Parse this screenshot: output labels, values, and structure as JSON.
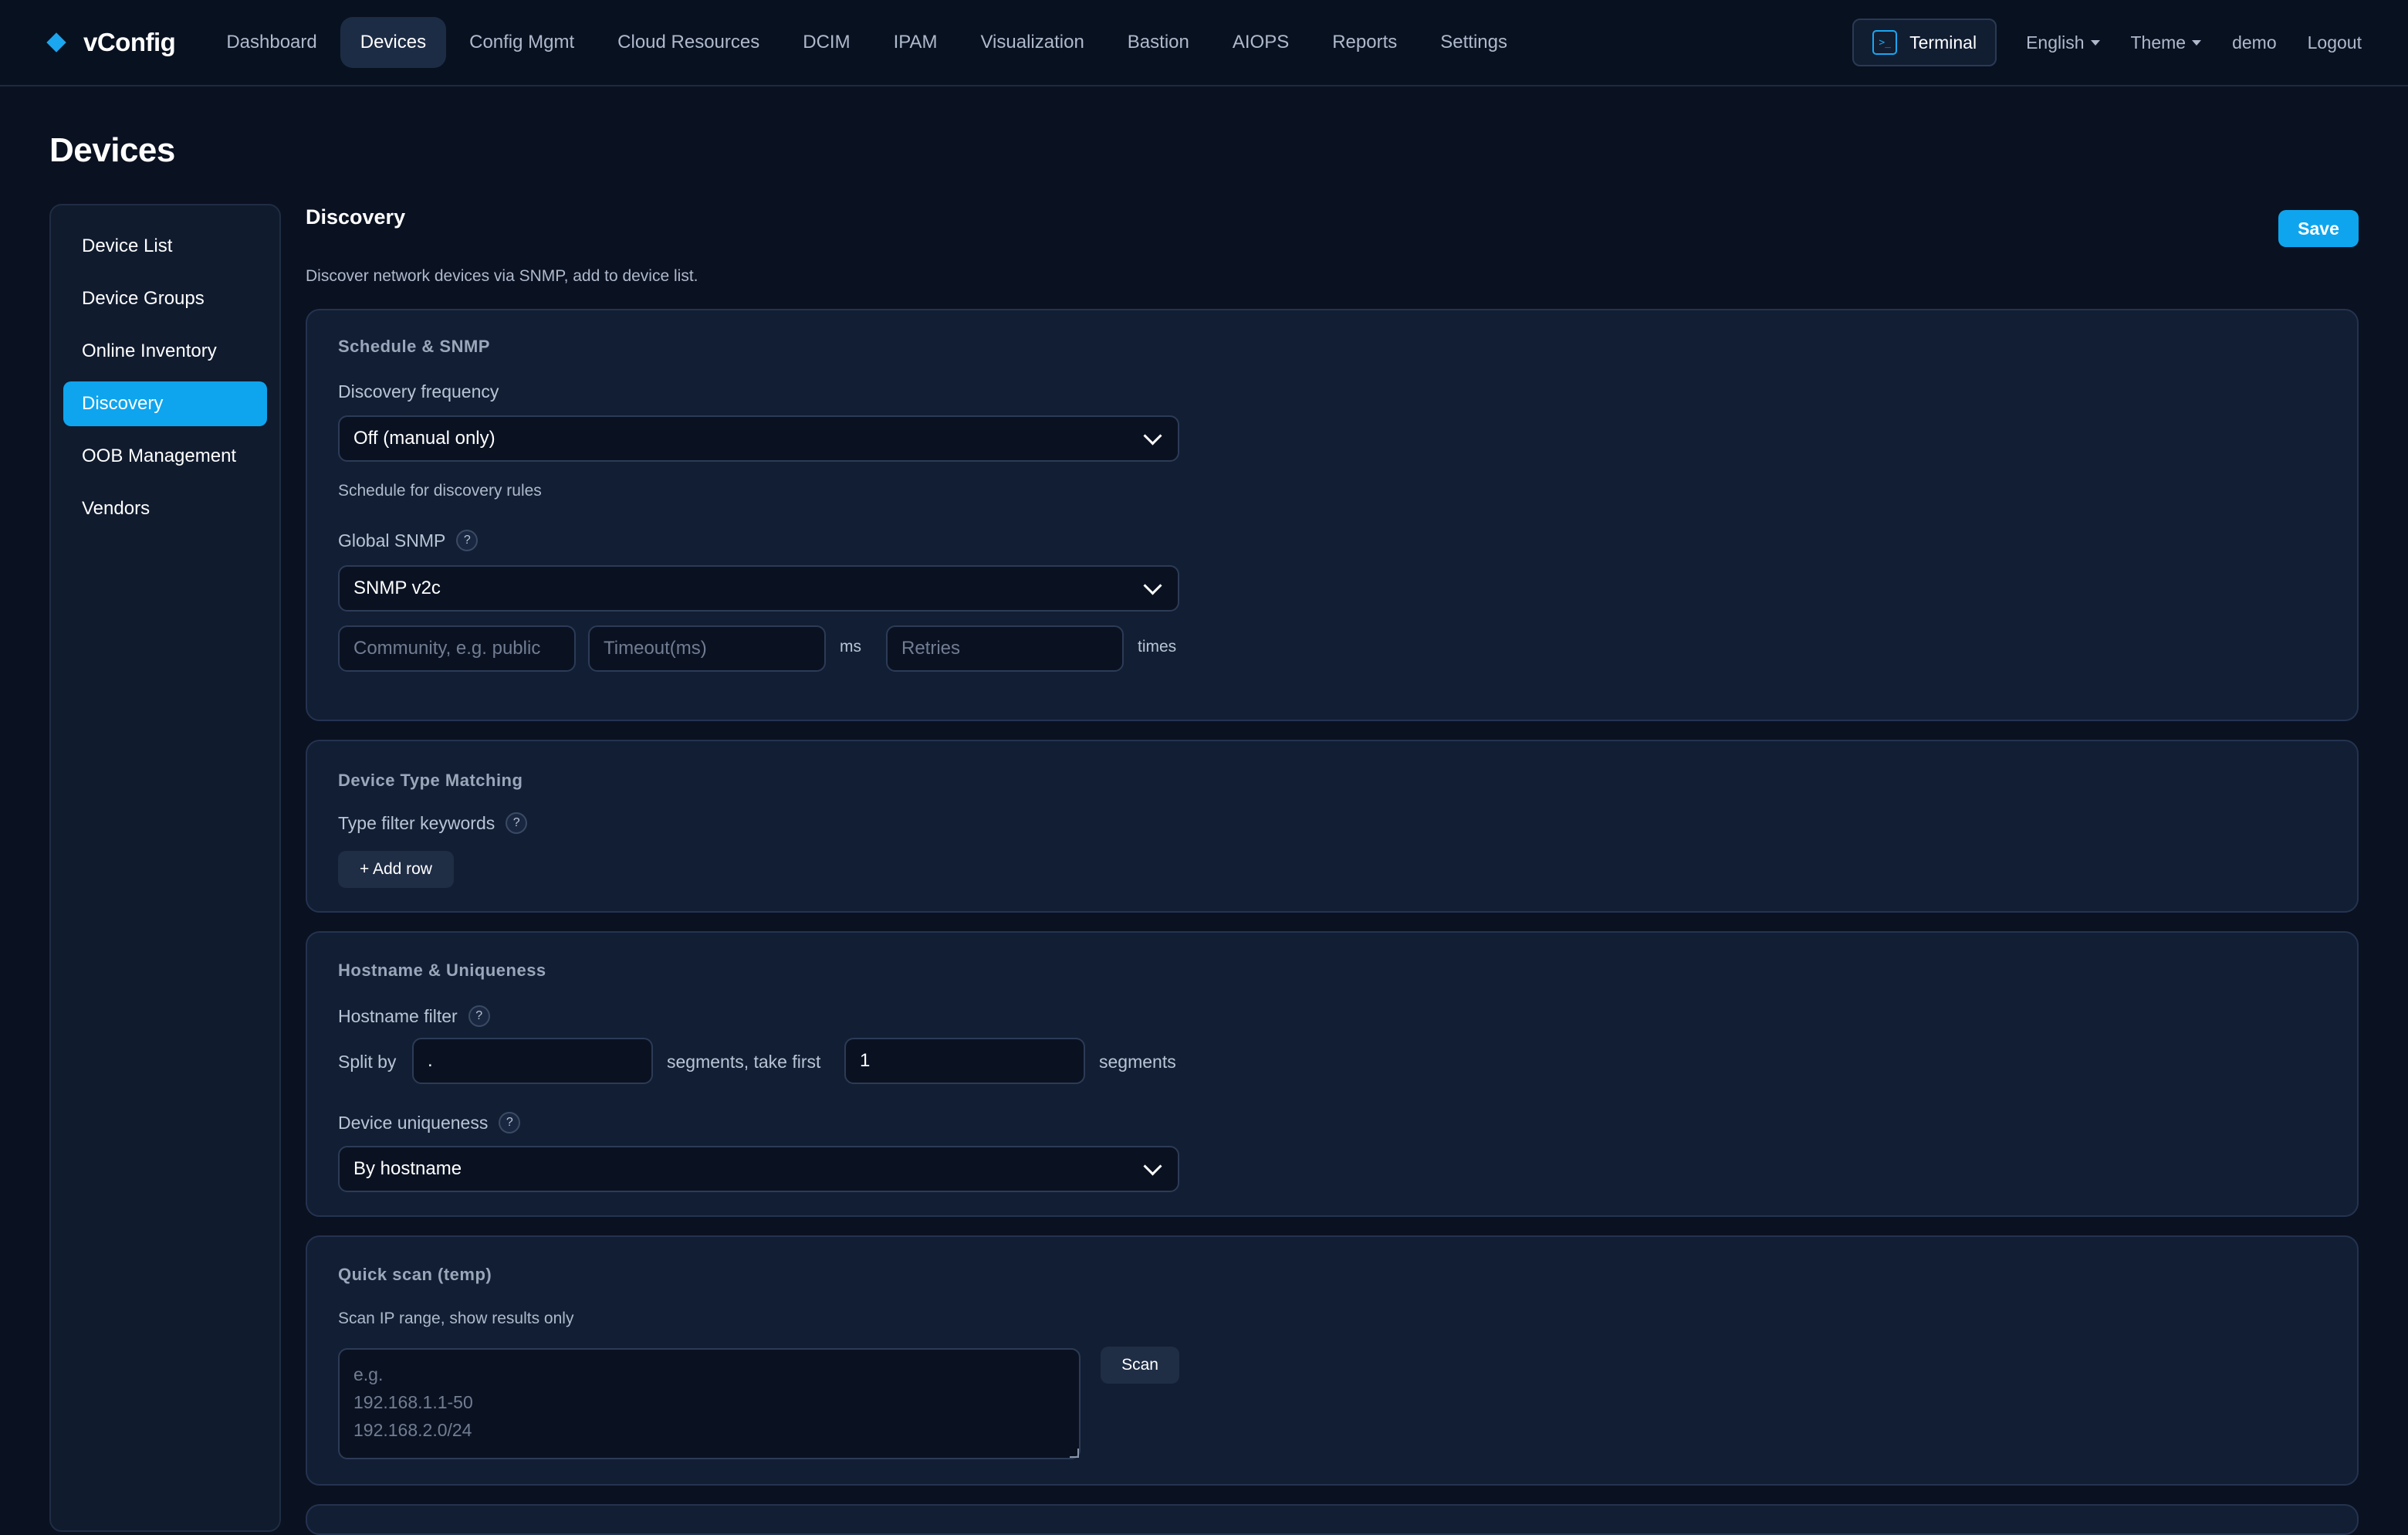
{
  "brand": {
    "name": "vConfig",
    "icon": "diamond-logo-icon",
    "accent": "#0ea5ee"
  },
  "nav": {
    "items": [
      {
        "label": "Dashboard",
        "active": false
      },
      {
        "label": "Devices",
        "active": true
      },
      {
        "label": "Config Mgmt",
        "active": false
      },
      {
        "label": "Cloud Resources",
        "active": false
      },
      {
        "label": "DCIM",
        "active": false
      },
      {
        "label": "IPAM",
        "active": false
      },
      {
        "label": "Visualization",
        "active": false
      },
      {
        "label": "Bastion",
        "active": false
      },
      {
        "label": "AIOPS",
        "active": false
      },
      {
        "label": "Reports",
        "active": false
      },
      {
        "label": "Settings",
        "active": false
      }
    ]
  },
  "topbar": {
    "terminal_label": "Terminal",
    "terminal_icon": "terminal-icon",
    "language": "English",
    "theme": "Theme",
    "user": "demo",
    "logout": "Logout"
  },
  "page": {
    "title": "Devices"
  },
  "sidebar": {
    "items": [
      {
        "label": "Device List",
        "active": false
      },
      {
        "label": "Device Groups",
        "active": false
      },
      {
        "label": "Online Inventory",
        "active": false
      },
      {
        "label": "Discovery",
        "active": true
      },
      {
        "label": "OOB Management",
        "active": false
      },
      {
        "label": "Vendors",
        "active": false
      }
    ]
  },
  "main": {
    "title": "Discovery",
    "save_label": "Save",
    "description": "Discover network devices via SNMP, add to device list."
  },
  "schedule": {
    "title": "Schedule & SNMP",
    "frequency_label": "Discovery frequency",
    "frequency_value": "Off (manual only)",
    "frequency_hint": "Schedule for discovery rules",
    "snmp_label": "Global SNMP",
    "snmp_value": "SNMP v2c",
    "community_placeholder": "Community, e.g. public",
    "timeout_placeholder": "Timeout(ms)",
    "timeout_unit": "ms",
    "retries_placeholder": "Retries",
    "retries_unit": "times"
  },
  "type_matching": {
    "title": "Device Type Matching",
    "keywords_label": "Type filter keywords",
    "add_row_label": "+ Add row"
  },
  "hostname": {
    "title": "Hostname & Uniqueness",
    "filter_label": "Hostname filter",
    "split_by_label": "Split by",
    "split_value": ".",
    "take_first_label": "segments, take first",
    "take_first_value": "1",
    "segments_label": "segments",
    "uniqueness_label": "Device uniqueness",
    "uniqueness_value": "By hostname"
  },
  "quick_scan": {
    "title": "Quick scan (temp)",
    "hint": "Scan IP range, show results only",
    "placeholder": "e.g.\n192.168.1.1-50\n192.168.2.0/24",
    "scan_label": "Scan"
  },
  "help_glyph": "?"
}
